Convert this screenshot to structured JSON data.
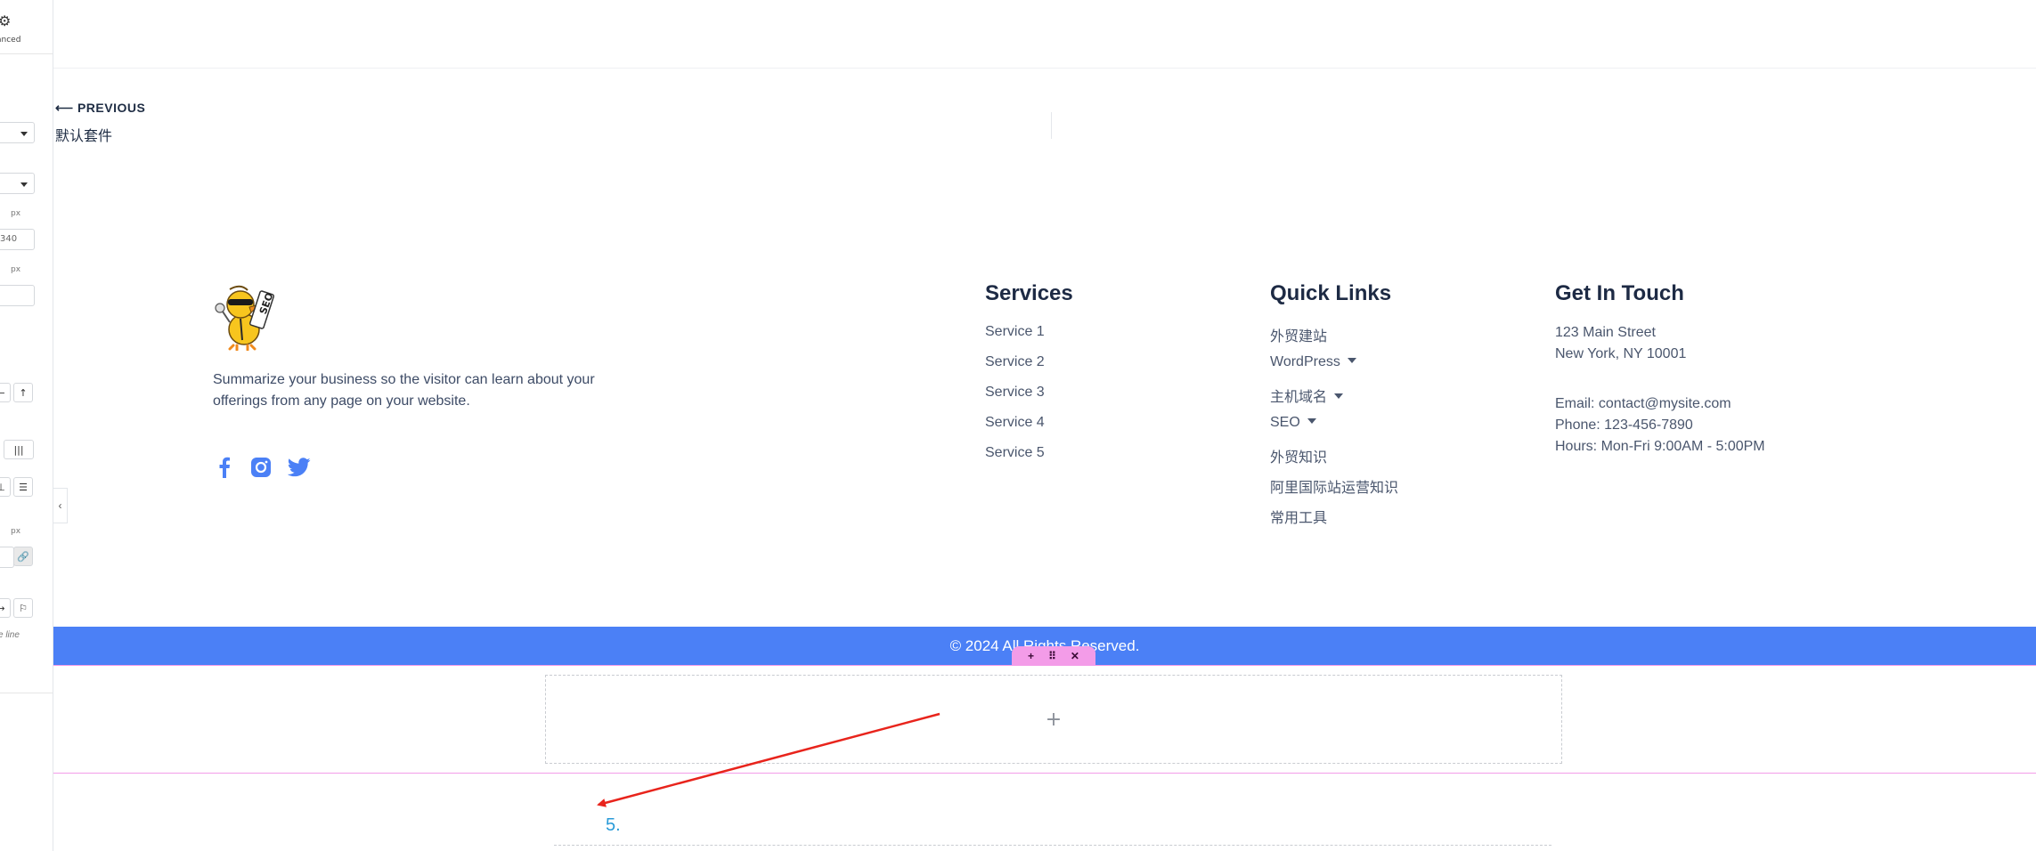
{
  "editor_panel": {
    "advanced_tab": "anced",
    "value_field": "340",
    "unit_1": "px",
    "unit_2": "px",
    "unit_3": "px",
    "note": "e line"
  },
  "post_nav": {
    "previous_label": "⟵ PREVIOUS",
    "previous_title": "默认套件"
  },
  "footer": {
    "description": "Summarize your business so the visitor can learn about your offerings from any page on your website.",
    "social": [
      "facebook-icon",
      "instagram-icon",
      "twitter-icon"
    ],
    "services": {
      "title": "Services",
      "items": [
        "Service 1",
        "Service 2",
        "Service 3",
        "Service 4",
        "Service 5"
      ]
    },
    "quick_links": {
      "title": "Quick Links",
      "items": [
        "外贸建站",
        "WordPress",
        "主机域名",
        "SEO",
        "外贸知识",
        "阿里国际站运营知识",
        "常用工具"
      ]
    },
    "contact": {
      "title": "Get In Touch",
      "address_line1": "123 Main Street",
      "address_line2": "New York, NY 10001",
      "email": "Email: contact@mysite.com",
      "phone": "Phone: 123-456-7890",
      "hours": "Hours: Mon-Fri 9:00AM - 5:00PM"
    },
    "copyright": "© 2024 All Rights Reserved."
  },
  "editor_section": {
    "handle_add": "+",
    "handle_move": "⠿",
    "handle_close": "✕",
    "add_widget": "+",
    "step_label": "5."
  },
  "colors": {
    "accent_blue": "#4b80f6",
    "section_pink": "#f39ce8",
    "arrow_red": "#e8241c"
  }
}
